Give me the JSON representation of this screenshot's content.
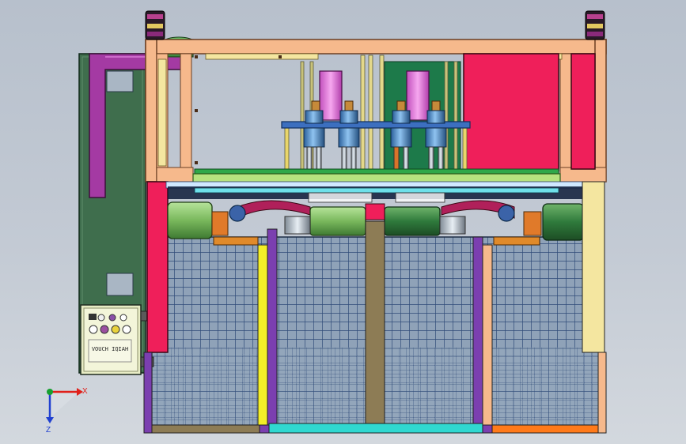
{
  "scene": {
    "view": "front",
    "panel_label": "VOUCH IQIAH",
    "colors": {
      "background_top": "#b7c0cc",
      "background_bottom": "#d3d8de",
      "frame_peach": "#f6b98c",
      "cabinet_green": "#3f6e4d",
      "duct_purple": "#a43aa3",
      "red_panel": "#ef1f5a",
      "mesh_blue": "#2f4b78",
      "cream": "#f4e6a0",
      "cyan": "#30d8d0",
      "orange": "#ff7a1a",
      "violet": "#7b3fb0",
      "yellow": "#f3ee28",
      "brown": "#8d7c55",
      "motor_green": "#86c36a",
      "steel_blue": "#3c6fbf"
    }
  },
  "axes": {
    "x_label": "X",
    "z_label": "Z",
    "x_color": "#e0201a",
    "y_color": "#18a030",
    "z_color": "#2040d0"
  }
}
